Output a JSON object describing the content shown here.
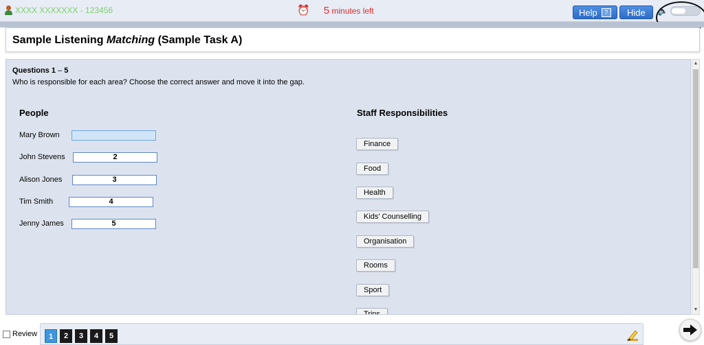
{
  "header": {
    "user": "XXXX XXXXXXX - 123456",
    "timer_number": "5",
    "timer_suffix": " minutes left",
    "help_label": "Help",
    "help_icon": "?",
    "hide_label": "Hide",
    "accent_color": "#2e6cc8",
    "timer_color": "#e12b2b"
  },
  "title": {
    "prefix": "Sample Listening ",
    "italic": "Matching",
    "suffix": " (Sample Task A)"
  },
  "question": {
    "range_bold": "Questions 1",
    "range_sep": " – ",
    "range_end": "5",
    "instruction": "Who is responsible for each area? Choose the correct answer and move it into the gap."
  },
  "people": {
    "heading": "People",
    "items": [
      {
        "name": "Mary Brown",
        "gap": ""
      },
      {
        "name": "John Stevens",
        "gap": "2"
      },
      {
        "name": "Alison Jones",
        "gap": "3"
      },
      {
        "name": "Tim Smith",
        "gap": "4"
      },
      {
        "name": "Jenny James",
        "gap": "5"
      }
    ]
  },
  "responsibilities": {
    "heading": "Staff Responsibilities",
    "items": [
      "Finance",
      "Food",
      "Health",
      "Kids' Counselling",
      "Organisation",
      "Rooms",
      "Sport",
      "Trips"
    ]
  },
  "footer": {
    "review_label": "Review",
    "questions": [
      "1",
      "2",
      "3",
      "4",
      "5"
    ],
    "active_question": "1"
  }
}
